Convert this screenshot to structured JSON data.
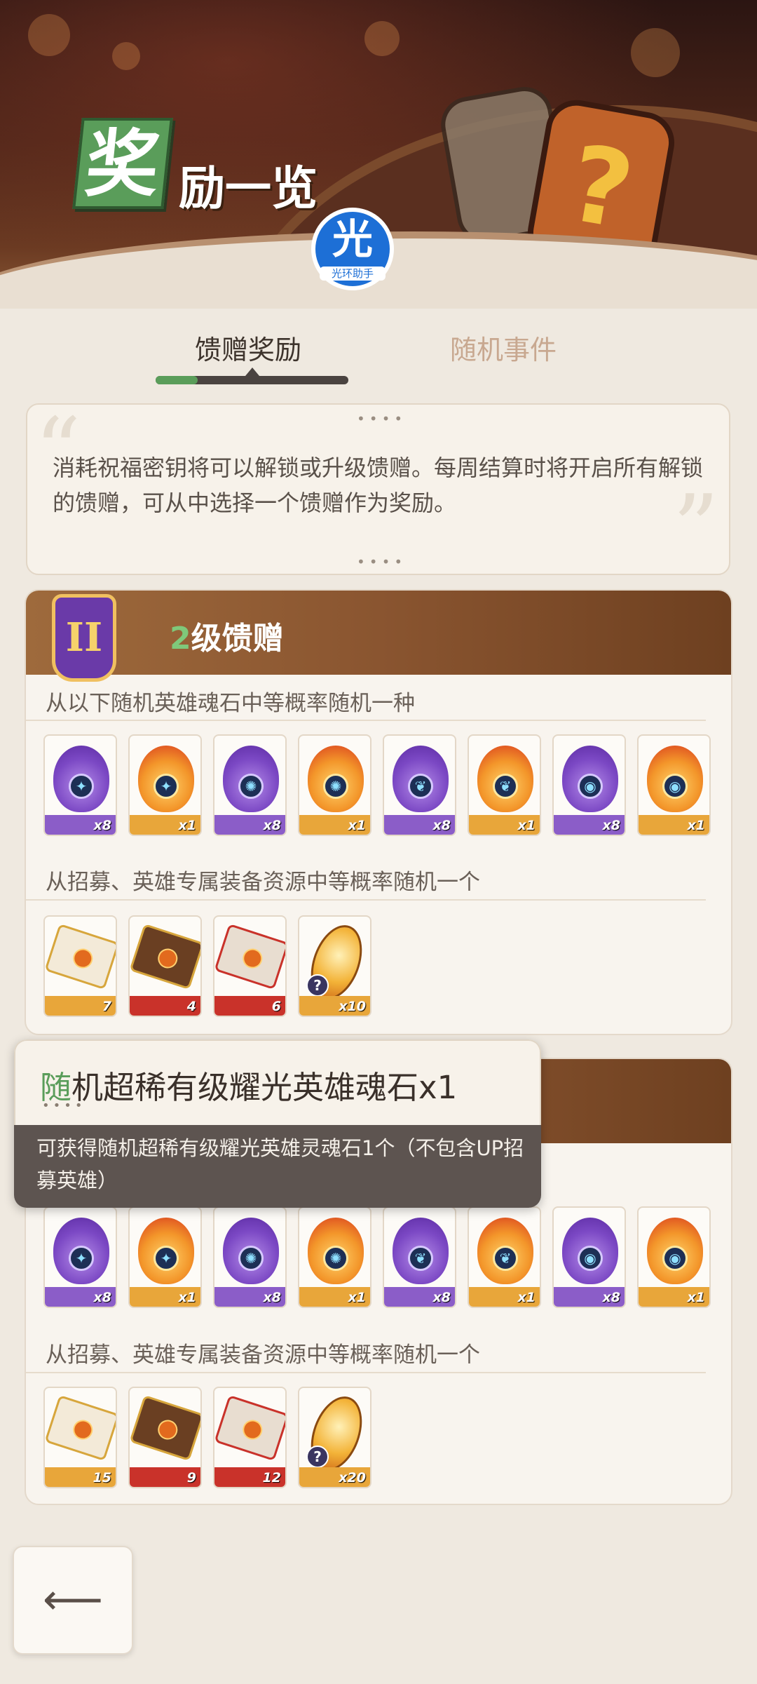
{
  "header": {
    "title_first_char": "奖",
    "title_rest": "励一览",
    "help_card_symbol": "?",
    "watermark_big": "光",
    "watermark_small": "光环助手"
  },
  "tabs": [
    {
      "label": "馈赠奖励",
      "active": true
    },
    {
      "label": "随机事件",
      "active": false
    }
  ],
  "description": {
    "dots": "••••",
    "text": "消耗祝福密钥将可以解锁或升级馈赠。每周结算时将开启所有解锁的馈赠，可从中选择一个馈赠作为奖励。"
  },
  "sections": [
    {
      "badge": "II",
      "title_num": "2",
      "title_rest": "级馈赠",
      "sub1": "从以下随机英雄魂石中等概率随机一种",
      "soulstones": [
        {
          "color": "purple",
          "glyph": "✦",
          "qty": "x8"
        },
        {
          "color": "fire",
          "glyph": "✦",
          "qty": "x1"
        },
        {
          "color": "purple",
          "glyph": "✺",
          "qty": "x8"
        },
        {
          "color": "fire",
          "glyph": "✺",
          "qty": "x1"
        },
        {
          "color": "purple",
          "glyph": "❦",
          "qty": "x8"
        },
        {
          "color": "fire",
          "glyph": "❦",
          "qty": "x1"
        },
        {
          "color": "purple",
          "glyph": "◉",
          "qty": "x8"
        },
        {
          "color": "fire",
          "glyph": "◉",
          "qty": "x1"
        }
      ],
      "sub2": "从招募、英雄专属装备资源中等概率随机一个",
      "resources": [
        {
          "kind": "white",
          "qty": "7"
        },
        {
          "kind": "dark",
          "qty": "4"
        },
        {
          "kind": "redenv",
          "qty": "6"
        },
        {
          "kind": "leaf",
          "qty": "x10"
        }
      ]
    },
    {
      "soulstones": [
        {
          "color": "purple",
          "glyph": "✦",
          "qty": "x8"
        },
        {
          "color": "fire",
          "glyph": "✦",
          "qty": "x1"
        },
        {
          "color": "purple",
          "glyph": "✺",
          "qty": "x8"
        },
        {
          "color": "fire",
          "glyph": "✺",
          "qty": "x1"
        },
        {
          "color": "purple",
          "glyph": "❦",
          "qty": "x8"
        },
        {
          "color": "fire",
          "glyph": "❦",
          "qty": "x1"
        },
        {
          "color": "purple",
          "glyph": "◉",
          "qty": "x8"
        },
        {
          "color": "fire",
          "glyph": "◉",
          "qty": "x1"
        }
      ],
      "sub2": "从招募、英雄专属装备资源中等概率随机一个",
      "resources": [
        {
          "kind": "white",
          "qty": "15"
        },
        {
          "kind": "dark",
          "qty": "9"
        },
        {
          "kind": "redenv",
          "qty": "12"
        },
        {
          "kind": "leaf",
          "qty": "x20"
        }
      ]
    }
  ],
  "tooltip": {
    "title_first": "随",
    "title_rest": "机超稀有级耀光英雄魂石x1",
    "dots": "••••",
    "body": "可获得随机超稀有级耀光英雄灵魂石1个（不包含UP招募英雄）"
  },
  "back_button": {
    "icon": "back-arrow-icon",
    "glyph": "⟵"
  },
  "colors": {
    "accent_green": "#5a9d5a",
    "header_brown": "#8a5530",
    "badge_purple": "#6a3aa8"
  }
}
